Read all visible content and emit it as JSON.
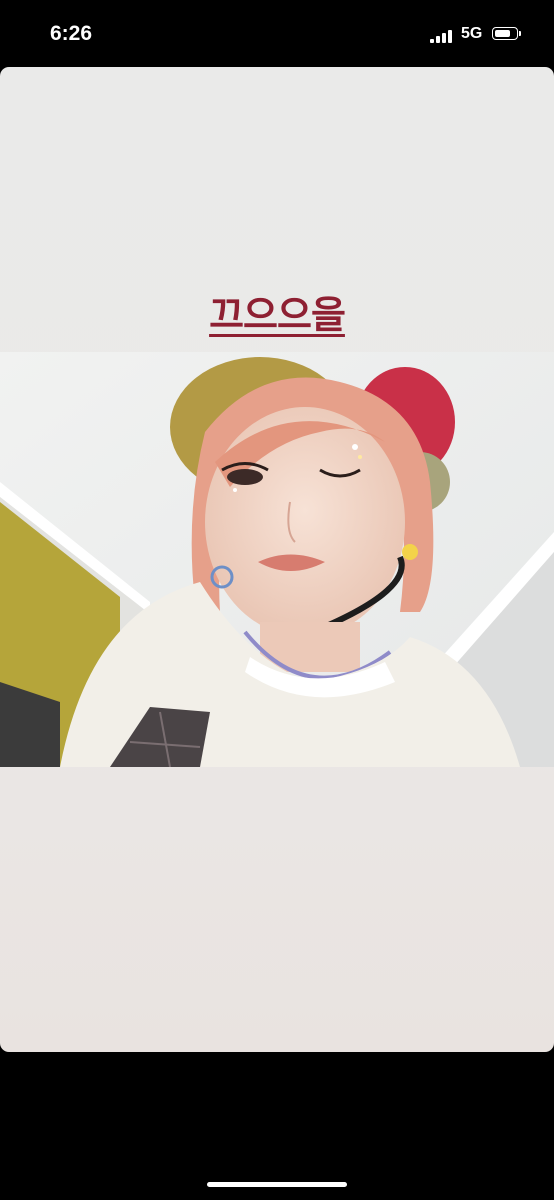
{
  "status_bar": {
    "time": "6:26",
    "network": "5G",
    "signal_bars": 4,
    "battery_level": 0.65
  },
  "story": {
    "caption": "끄으으을",
    "caption_color": "#8e2032",
    "photo": "selfie-winking"
  }
}
